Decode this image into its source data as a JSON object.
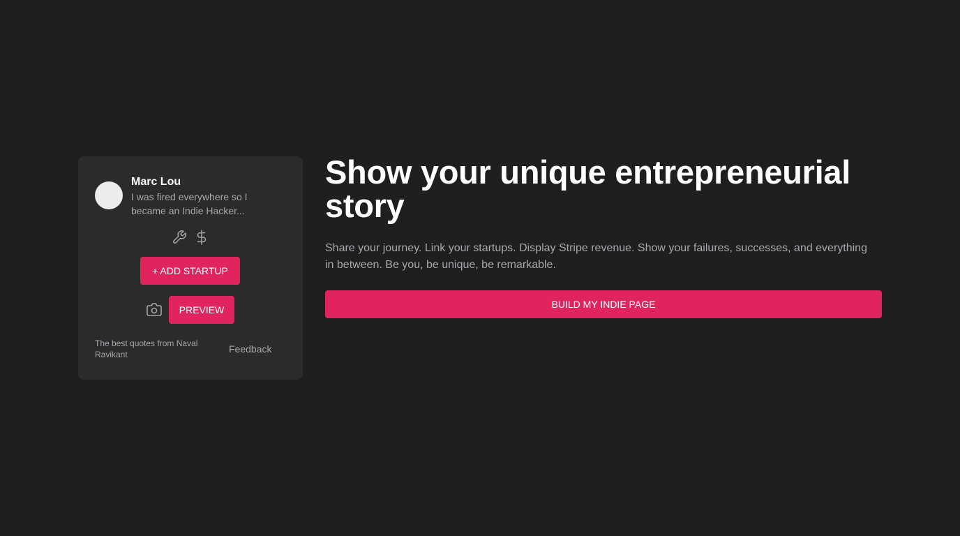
{
  "profile": {
    "name": "Marc Lou",
    "bio": "I was fired everywhere so I became an Indie Hacker..."
  },
  "profile_icons": [
    "wrench-icon",
    "dollar-icon"
  ],
  "buttons": {
    "add_startup": "+ ADD STARTUP",
    "preview": "PREVIEW",
    "build_page": "BUILD MY INDIE PAGE"
  },
  "card_footer": {
    "quotes_link": "The best quotes from Naval Ravikant",
    "feedback_link": "Feedback"
  },
  "hero": {
    "title": "Show your unique entrepreneurial story",
    "description": "Share your journey. Link your startups. Display Stripe revenue. Show your failures, successes, and everything in between. Be you, be unique, be remarkable."
  },
  "colors": {
    "background": "#1f1f1f",
    "card": "#2b2b2b",
    "accent": "#e0245e",
    "muted_text": "#a7a7ad",
    "text": "#ffffff"
  }
}
